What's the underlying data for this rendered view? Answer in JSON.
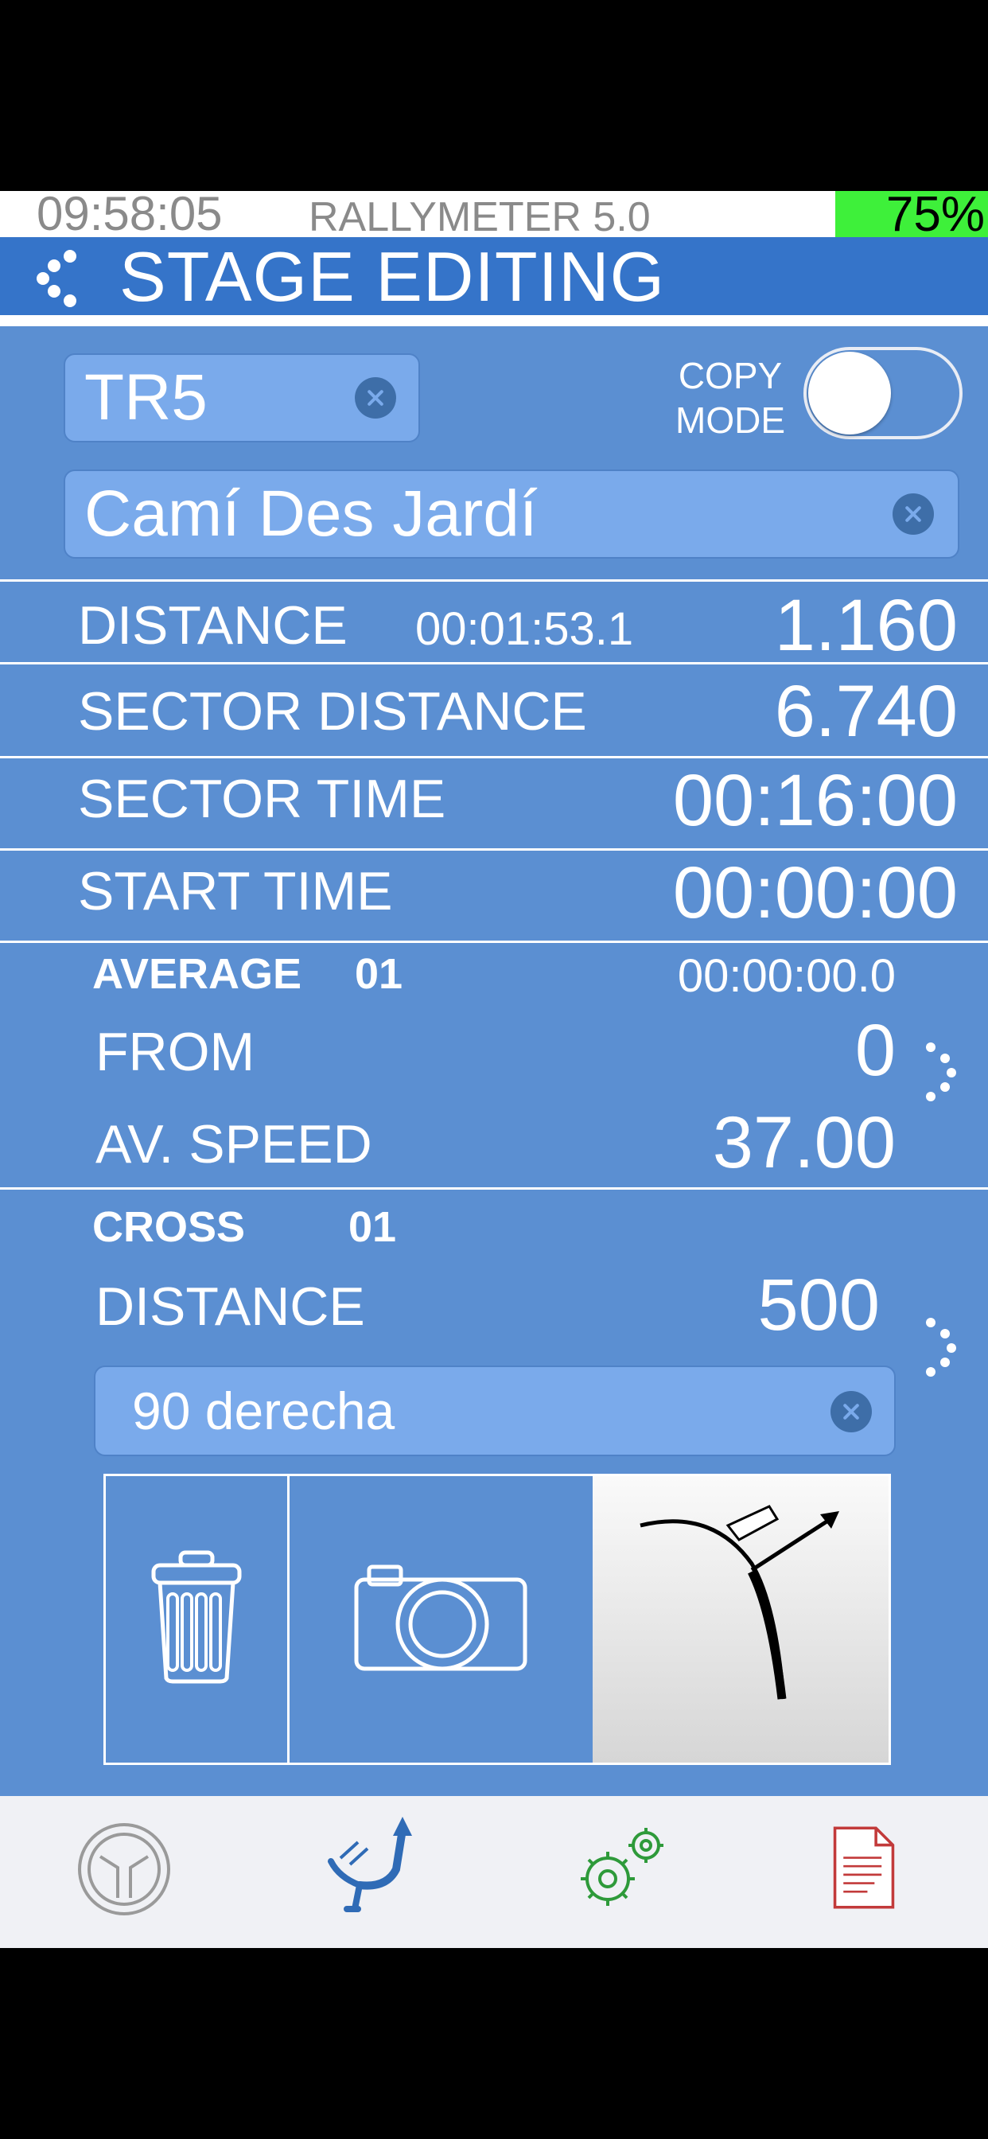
{
  "status_bar": {
    "time": "09:58:05",
    "app_name": "RALLYMETER 5.0",
    "battery": "75%"
  },
  "header": {
    "title": "STAGE EDITING",
    "back_icon": "back-dots-icon"
  },
  "stage": {
    "code": "TR5",
    "name": "Camí Des Jardí",
    "copy_mode_label_line1": "COPY",
    "copy_mode_label_line2": "MODE",
    "copy_mode_on": false
  },
  "rows": {
    "distance_label": "DISTANCE",
    "distance_time": "00:01:53.1",
    "distance_value": "1.160",
    "sector_distance_label": "SECTOR DISTANCE",
    "sector_distance_value": "6.740",
    "sector_time_label": "SECTOR TIME",
    "sector_time_value": "00:16:00",
    "start_time_label": "START TIME",
    "start_time_value": "00:00:00"
  },
  "average": {
    "title": "AVERAGE",
    "number": "01",
    "time": "00:00:00.0",
    "from_label": "FROM",
    "from_value": "0",
    "speed_label": "AV. SPEED",
    "speed_value": "37.00"
  },
  "cross": {
    "title": "CROSS",
    "number": "01",
    "distance_label": "DISTANCE",
    "distance_value": "500",
    "note": "90 derecha",
    "icons": [
      "trash-icon",
      "camera-icon",
      "route-diagram-image"
    ]
  },
  "tabs": [
    {
      "icon": "steering-wheel-icon",
      "color": "#9a9a9a"
    },
    {
      "icon": "road-route-icon",
      "color": "#2f6bb6"
    },
    {
      "icon": "gears-icon",
      "color": "#2e9a3a"
    },
    {
      "icon": "document-icon",
      "color": "#c23a3a"
    }
  ]
}
